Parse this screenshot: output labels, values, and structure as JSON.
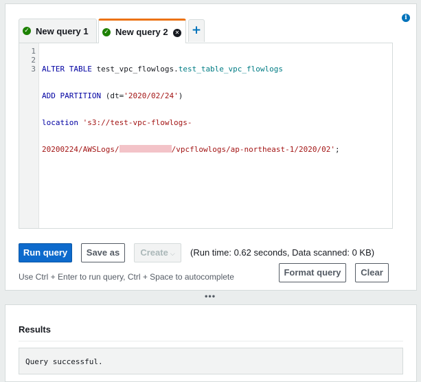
{
  "info_icon": "info-icon",
  "tabs": [
    {
      "label": "New query 1",
      "status_icon": "check-circle-icon",
      "active": false
    },
    {
      "label": "New query 2",
      "status_icon": "check-circle-icon",
      "active": true,
      "close_icon": "close-circle-icon"
    }
  ],
  "add_tab_icon": "plus-icon",
  "editor": {
    "line_numbers": [
      "1",
      "2",
      "3"
    ],
    "lines": [
      {
        "kw": "ALTER TABLE",
        "plain": " test_vpc_flowlogs.",
        "table": "test_table_vpc_flowlogs"
      },
      {
        "kw": "ADD PARTITION",
        "plain": " (dt=",
        "string": "'2020/02/24'",
        "plain_end": ")"
      },
      {
        "kw": "location",
        "plain": " ",
        "string": "'s3://test-vpc-flowlogs-"
      },
      {
        "string_start": "20200224/AWSLogs/",
        "redacted": true,
        "string_end": "/vpcflowlogs/ap-northeast-1/2020/02'",
        "plain_end": ";"
      }
    ]
  },
  "buttons": {
    "run_query": "Run query",
    "save_as": "Save as",
    "create": "Create",
    "format_query": "Format query",
    "clear": "Clear"
  },
  "run_stats": "(Run time: 0.62 seconds, Data scanned: 0 KB)",
  "hint": "Use Ctrl + Enter to run query, Ctrl + Space to autocomplete",
  "drag_handle": "•••",
  "results": {
    "title": "Results",
    "message": "Query successful."
  },
  "colors": {
    "primary": "#0d6acc",
    "active_tab_accent": "#ec7211",
    "success": "#1d8102",
    "keyword": "#0000a2",
    "string": "#a31515",
    "table": "#007c84"
  }
}
